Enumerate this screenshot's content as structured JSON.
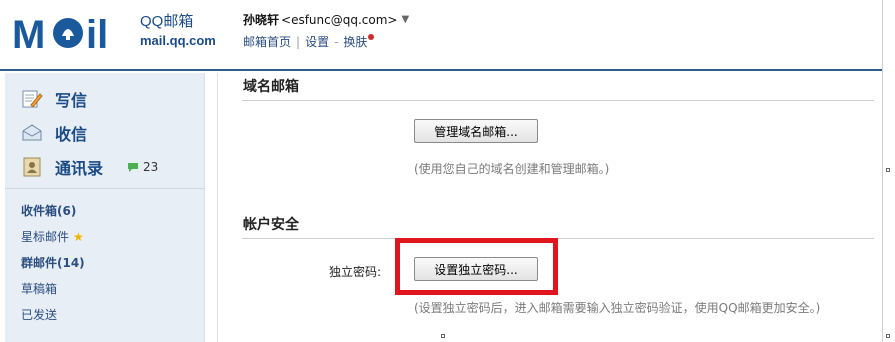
{
  "header": {
    "logo_text": "MOil",
    "brand_title": "QQ邮箱",
    "brand_url": "mail.qq.com",
    "user_name": "孙晓轩",
    "user_email": "<esfunc@qq.com>",
    "caret": "▼",
    "nav": [
      {
        "label": "邮箱首页"
      },
      {
        "label": "设置"
      },
      {
        "label": "换肤"
      }
    ],
    "nav_sep_1": "|",
    "nav_sep_2": "-"
  },
  "sidebar": {
    "primary": [
      {
        "label": "写信",
        "icon": "compose-icon"
      },
      {
        "label": "收信",
        "icon": "inbox-icon"
      },
      {
        "label": "通讯录",
        "icon": "contacts-icon"
      }
    ],
    "contacts_badge": "23",
    "folders": [
      {
        "label": "收件箱(6)"
      },
      {
        "label": "星标邮件"
      },
      {
        "label": "群邮件(14)"
      },
      {
        "label": "草稿箱"
      },
      {
        "label": "已发送"
      }
    ]
  },
  "main": {
    "domain_section": {
      "title": "域名邮箱",
      "button": "管理域名邮箱...",
      "hint": "(使用您自己的域名创建和管理邮箱。)"
    },
    "security_section": {
      "title": "帐户安全",
      "field_label": "独立密码:",
      "button": "设置独立密码...",
      "hint": "(设置独立密码后，进入邮箱需要输入独立密码验证，使用QQ邮箱更加安全。)"
    }
  },
  "colors": {
    "brand_blue": "#1a4b86",
    "header_rule": "#2d5c8d",
    "sidebar_bg": "#e8eef5",
    "highlight_red": "#e0151d"
  }
}
